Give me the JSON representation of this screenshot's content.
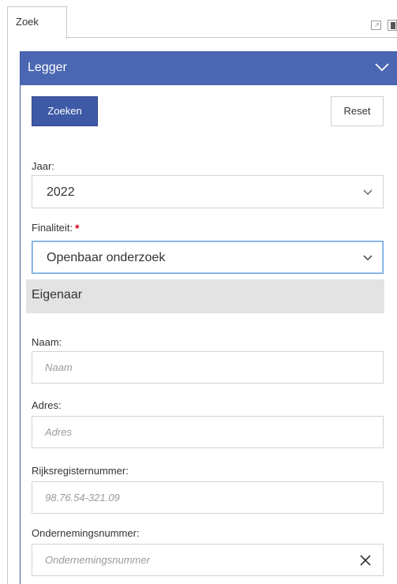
{
  "tab": {
    "label": "Zoek"
  },
  "panel": {
    "title": "Legger",
    "search_button": "Zoeken",
    "reset_button": "Reset"
  },
  "fields": {
    "jaar": {
      "label": "Jaar:",
      "value": "2022"
    },
    "finaliteit": {
      "label": "Finaliteit:",
      "required_mark": "*",
      "value": "Openbaar onderzoek"
    }
  },
  "section": {
    "title": "Eigenaar"
  },
  "owner": {
    "naam": {
      "label": "Naam:",
      "placeholder": "Naam"
    },
    "adres": {
      "label": "Adres:",
      "placeholder": "Adres"
    },
    "rijksregisternummer": {
      "label": "Rijksregisternummer:",
      "placeholder": "98.76.54-321.09"
    },
    "ondernemingsnummer": {
      "label": "Ondernemingsnummer:",
      "placeholder": "Ondernemingsnummer"
    }
  },
  "colors": {
    "header_blue": "#4b66b2",
    "button_blue": "#3e5aa6",
    "section_gray": "#e3e3e3",
    "required_red": "#d0021b",
    "focus_border": "#6ba3e3"
  },
  "icons": [
    "restore-window-icon",
    "dock-icon",
    "chevron-down-icon",
    "close-icon"
  ]
}
